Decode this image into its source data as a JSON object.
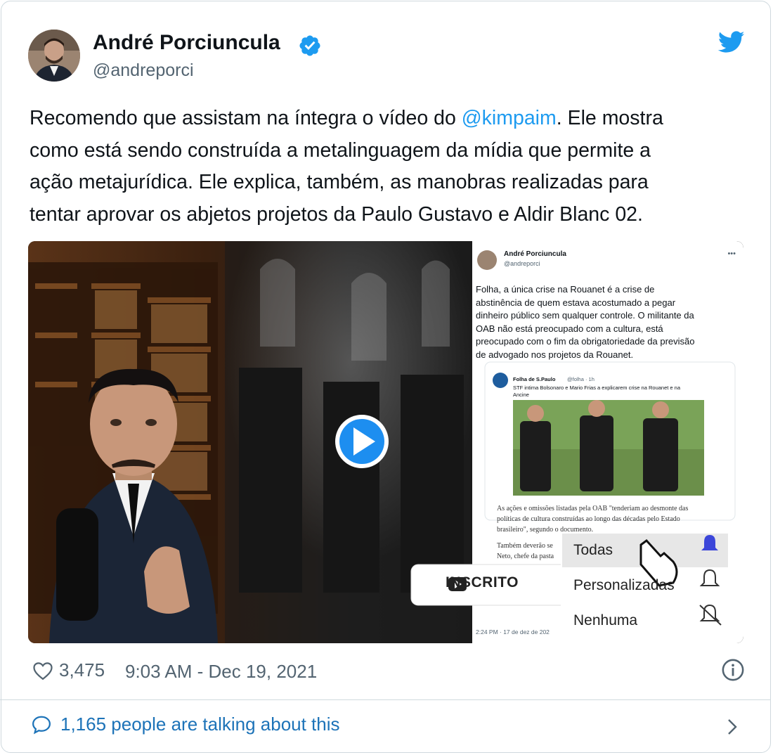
{
  "author": {
    "name": "André Porciuncula",
    "handle": "@andreporci"
  },
  "tweet": {
    "lines": [
      [
        "Recomendo que assistam na íntegra o vídeo do ",
        "@kimpaim",
        ". Ele mostra"
      ],
      "como está sendo construída a metalinguagem da mídia que permite a",
      "ação metajurídica. Ele explica, também, as manobras realizadas para",
      "tentar aprovar os abjetos projetos da Paulo Gustavo e Aldir Blanc 02."
    ]
  },
  "embedded": {
    "name": "André Porciuncula",
    "handle": "@andreporci",
    "text_lines": [
      "Folha, a única crise na Rouanet é a crise de",
      "abstinência de quem estava acostumado a pegar",
      "dinheiro público sem qualquer controle. O militante da",
      "OAB não está preocupado com a cultura, está",
      "preocupado com o fim da obrigatoriedade da previsão",
      "de advogado nos projetos da Rouanet."
    ],
    "quote": {
      "source": "Folha de S.Paulo",
      "meta": "@folha · 1h",
      "text_lines": [
        "STF intima Bolsonaro e Mario Frias a explicarem crise na Rouanet e na",
        "Ancine"
      ],
      "article_lines": [
        "As ações e omissões listadas pela OAB \"tenderiam ao desmonte das",
        "políticas de cultura construídas ao longo das décadas pelo Estado",
        "brasileiro\", segundo o documento.",
        "Também deverão se",
        "Neto, chefe da pasta"
      ]
    },
    "timestamp": "2:24 PM · 17 de dez de 202"
  },
  "subscribe": {
    "button_label": "INSCRITO",
    "options": [
      "Todas",
      "Personalizadas",
      "Nenhuma"
    ]
  },
  "footer": {
    "likes": "3,475",
    "timestamp": "9:03 AM - Dec 19, 2021",
    "talking": "1,165 people are talking about this"
  },
  "colors": {
    "accent": "#1d9bf0",
    "link_blue": "#1d73b8",
    "subscribe_bell": "#3b46d9",
    "play": "#1d8ef0"
  }
}
